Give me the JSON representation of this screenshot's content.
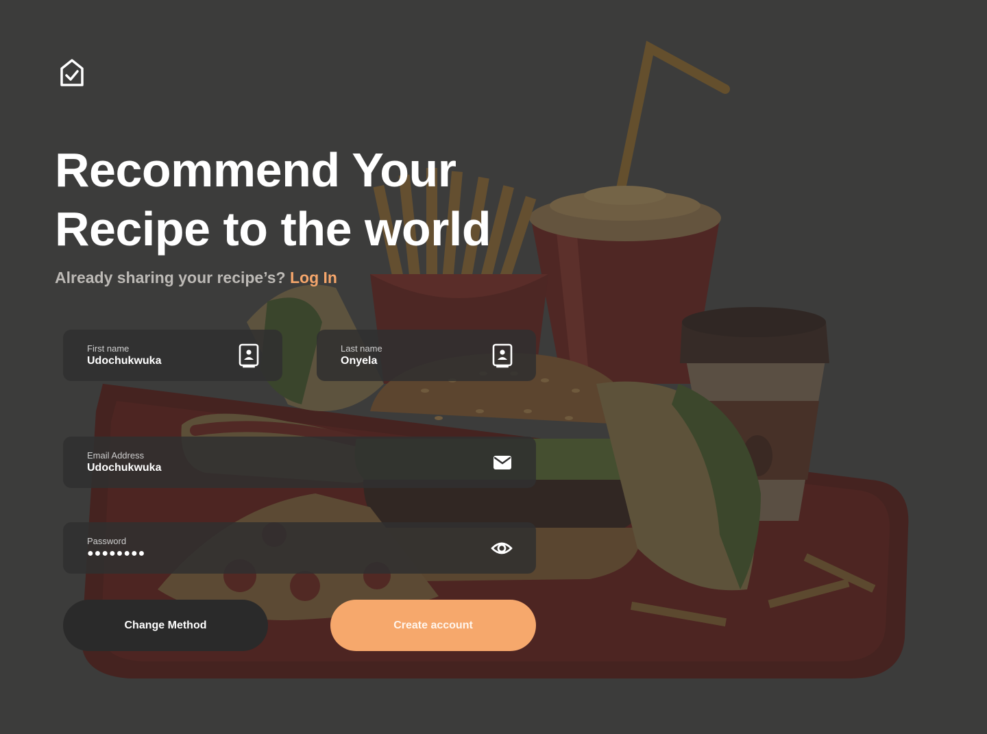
{
  "brand": {
    "logo_icon": "house-check-icon"
  },
  "hero": {
    "title_line1": "Recommend Your",
    "title_line2": "Recipe to the world",
    "subtitle": "Already sharing your recipe’s?",
    "login_link": "Log In"
  },
  "form": {
    "first_name": {
      "label": "First name",
      "value": "Udochukwuka",
      "icon": "contact-card-icon"
    },
    "last_name": {
      "label": "Last name",
      "value": "Onyela",
      "icon": "contact-card-icon"
    },
    "email": {
      "label": "Email Address",
      "value": "Udochukwuka",
      "icon": "envelope-icon"
    },
    "password": {
      "label": "Password",
      "value": "●●●●●●●●",
      "icon": "eye-icon"
    }
  },
  "actions": {
    "change_method": "Change Method",
    "create_account": "Create account"
  },
  "colors": {
    "background": "#3d3c3b",
    "accent": "#f6a86c",
    "field_bg": "#303030",
    "secondary_button": "#2a2a2a"
  }
}
